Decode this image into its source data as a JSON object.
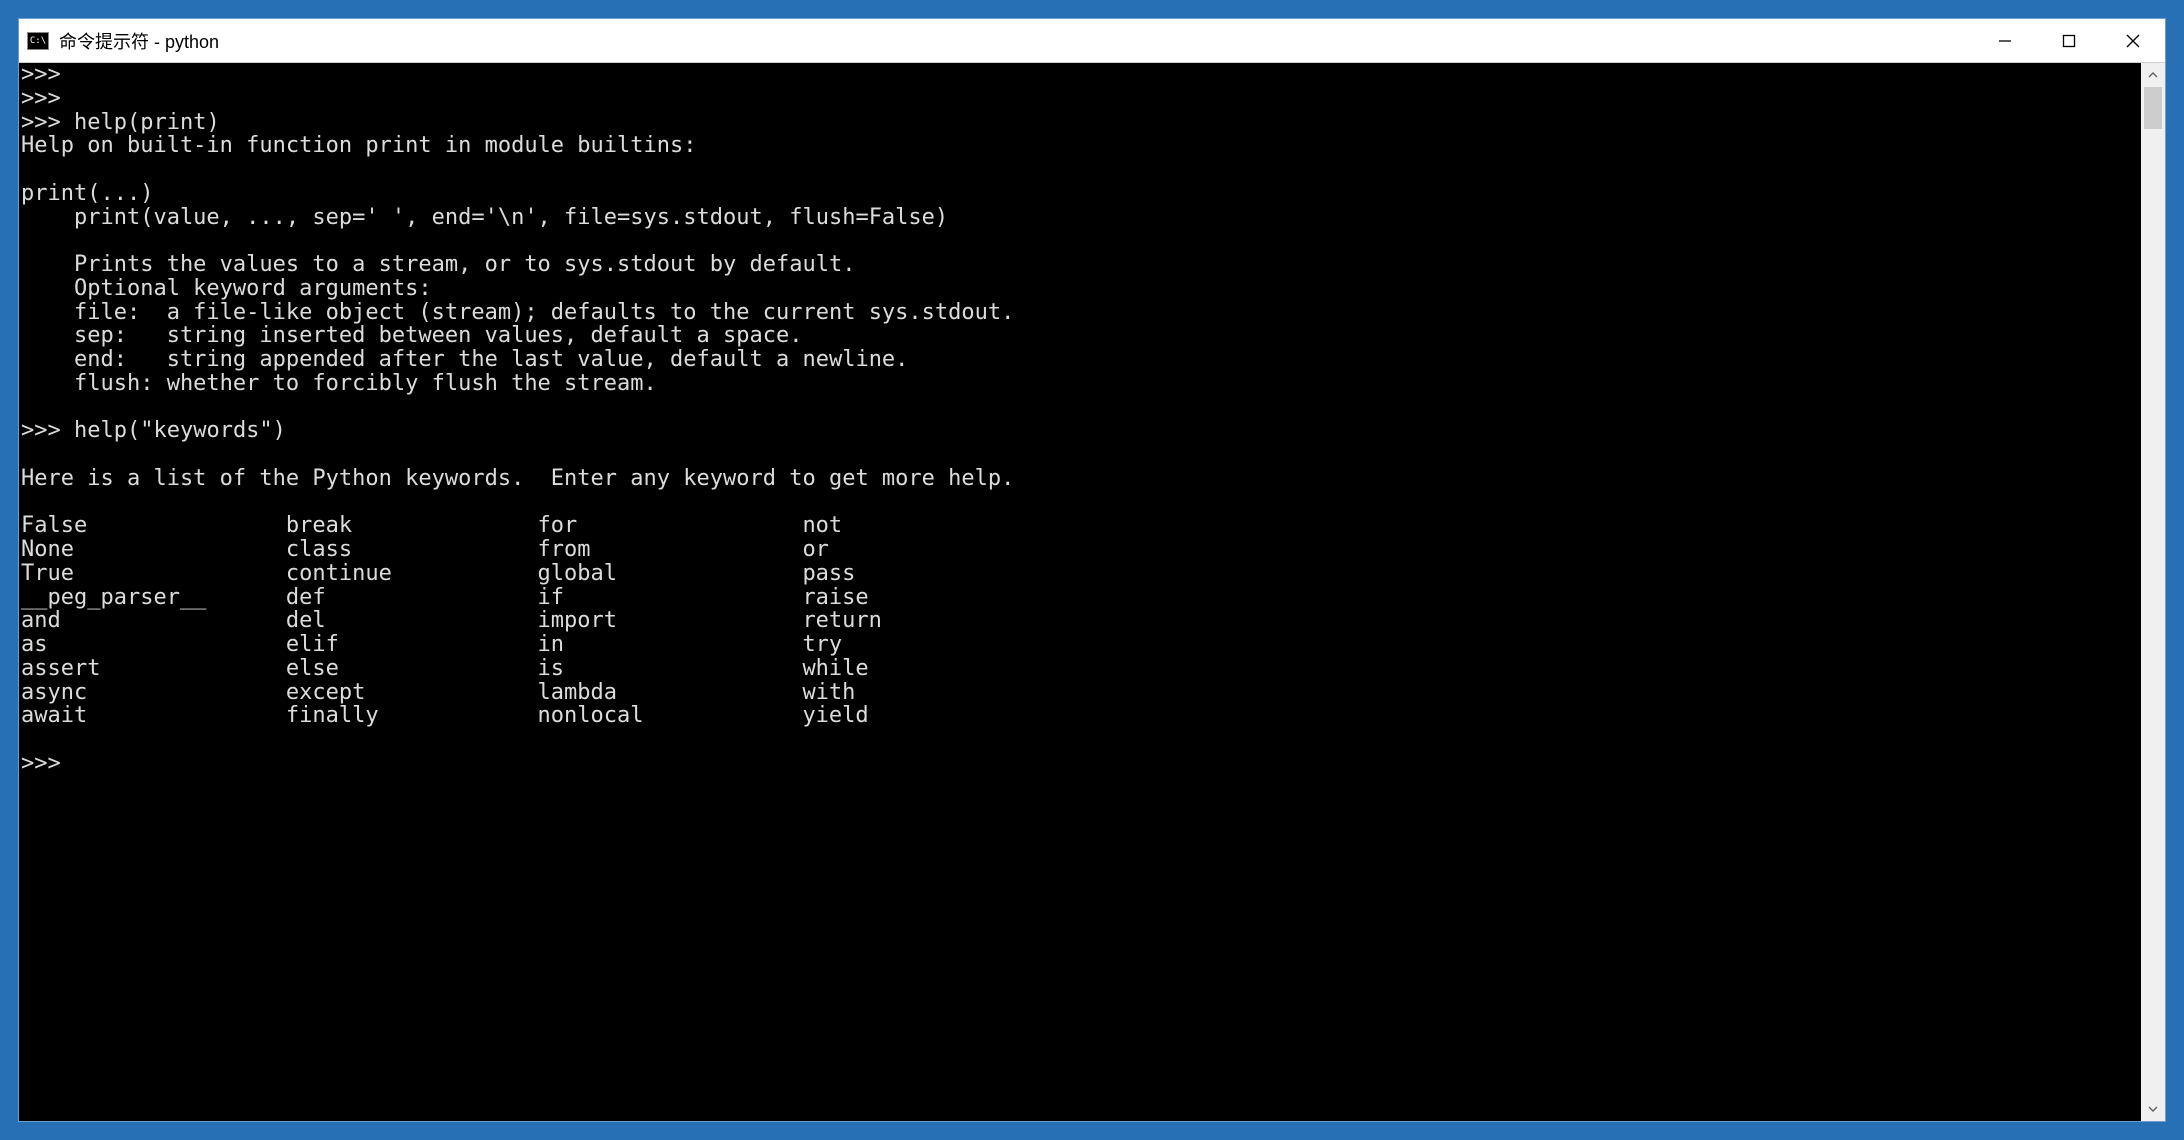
{
  "window": {
    "icon_text": "C:\\",
    "title": "命令提示符 - python"
  },
  "console": {
    "prompt": ">>>",
    "cmd_help_print": "help(print)",
    "help_print_header": "Help on built-in function print in module builtins:",
    "print_sig1": "print(...)",
    "print_sig2": "    print(value, ..., sep=' ', end='\\n', file=sys.stdout, flush=False)",
    "print_desc1": "    Prints the values to a stream, or to sys.stdout by default.",
    "print_desc2": "    Optional keyword arguments:",
    "print_desc3": "    file:  a file-like object (stream); defaults to the current sys.stdout.",
    "print_desc4": "    sep:   string inserted between values, default a space.",
    "print_desc5": "    end:   string appended after the last value, default a newline.",
    "print_desc6": "    flush: whether to forcibly flush the stream.",
    "cmd_help_keywords": "help(\"keywords\")",
    "keywords_intro": "Here is a list of the Python keywords.  Enter any keyword to get more help.",
    "keywords": {
      "col1": [
        "False",
        "None",
        "True",
        "__peg_parser__",
        "and",
        "as",
        "assert",
        "async",
        "await"
      ],
      "col2": [
        "break",
        "class",
        "continue",
        "def",
        "del",
        "elif",
        "else",
        "except",
        "finally"
      ],
      "col3": [
        "for",
        "from",
        "global",
        "if",
        "import",
        "in",
        "is",
        "lambda",
        "nonlocal"
      ],
      "col4": [
        "not",
        "or",
        "pass",
        "raise",
        "return",
        "try",
        "while",
        "with",
        "yield"
      ]
    }
  }
}
